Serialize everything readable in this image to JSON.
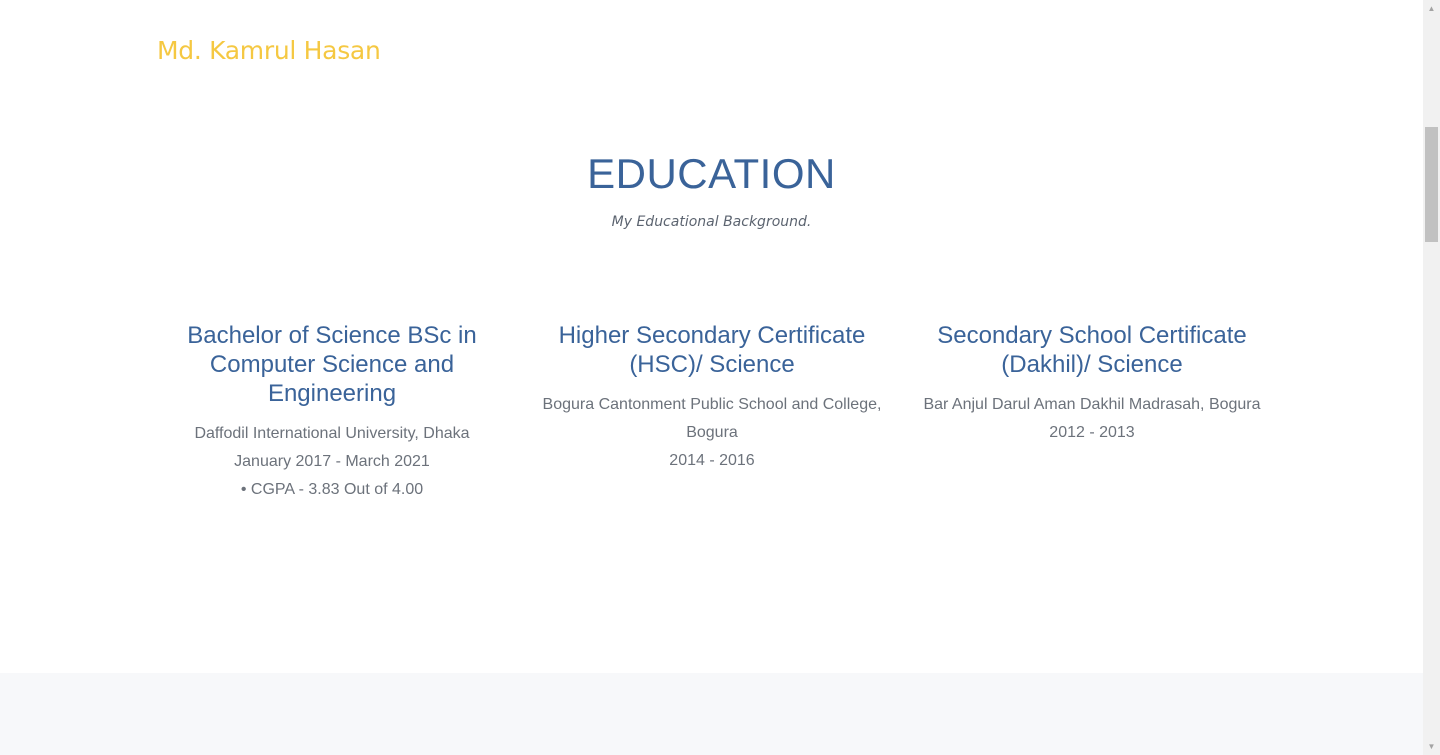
{
  "header": {
    "brand": "Md. Kamrul Hasan"
  },
  "education": {
    "title": "EDUCATION",
    "subtitle": "My Educational Background.",
    "items": [
      {
        "degree": "Bachelor of Science BSc in Computer Science and Engineering",
        "institution": "Daffodil International University, Dhaka",
        "period": "January 2017 - March 2021",
        "note": "• CGPA - 3.83 Out of 4.00"
      },
      {
        "degree": "Higher Secondary Certificate (HSC)/ Science",
        "institution": "Bogura Cantonment Public School and College, Bogura",
        "period": "2014 - 2016"
      },
      {
        "degree": "Secondary School Certificate (Dakhil)/ Science",
        "institution": "Bar Anjul Darul Aman Dakhil Madrasah, Bogura",
        "period": "2012 - 2013"
      }
    ]
  },
  "scrollbar": {
    "up_icon": "triangle-up",
    "down_icon": "triangle-down"
  },
  "colors": {
    "brand": "#f5c842",
    "heading": "#3a6399",
    "text": "#6c727b"
  }
}
